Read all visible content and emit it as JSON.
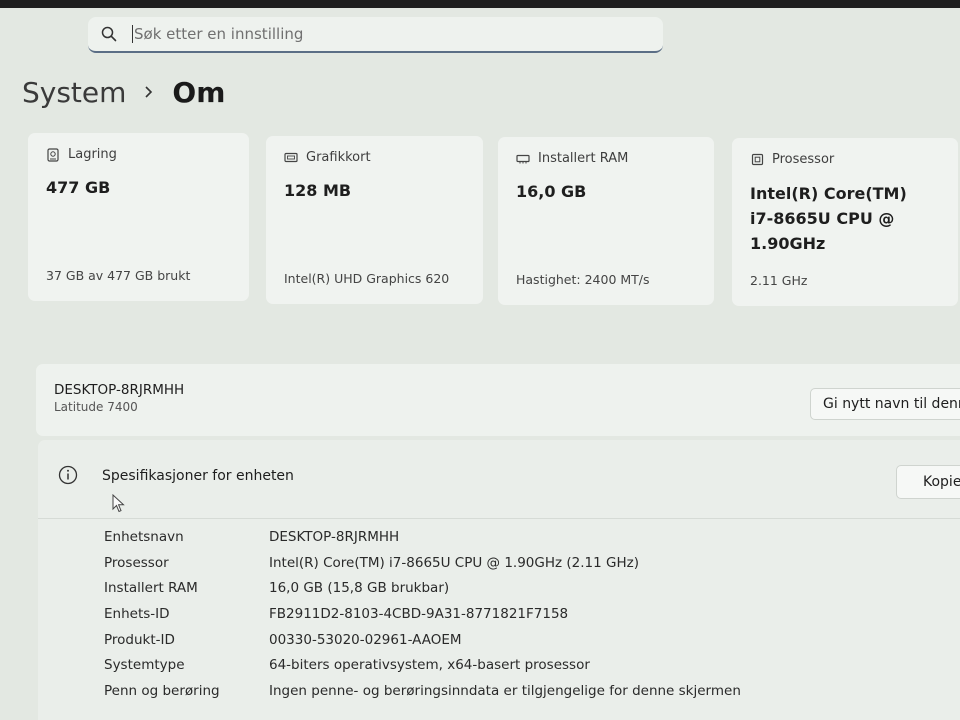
{
  "search": {
    "placeholder": "Søk etter en innstilling"
  },
  "breadcrumb": {
    "parent": "System",
    "current": "Om"
  },
  "cards": [
    {
      "title": "Lagring",
      "icon": "storage-icon",
      "value": "477 GB",
      "sub": "37 GB av 477 GB brukt"
    },
    {
      "title": "Grafikkort",
      "icon": "display-card-icon",
      "value": "128 MB",
      "sub": "Intel(R) UHD Graphics 620"
    },
    {
      "title": "Installert RAM",
      "icon": "ram-icon",
      "value": "16,0 GB",
      "sub": "Hastighet: 2400 MT/s"
    },
    {
      "title": "Prosessor",
      "icon": "processor-icon",
      "value_lines": [
        "Intel(R) Core(TM)",
        "i7-8665U CPU @",
        "1.90GHz"
      ],
      "sub": "2.11 GHz"
    }
  ],
  "device": {
    "name": "DESKTOP-8RJRMHH",
    "model": "Latitude 7400",
    "rename_label": "Gi nytt navn til denne PC-en"
  },
  "specs": {
    "title": "Spesifikasjoner for enheten",
    "copy_label": "Kopier",
    "rows": [
      {
        "label": "Enhetsnavn",
        "value": "DESKTOP-8RJRMHH"
      },
      {
        "label": "Prosessor",
        "value": "Intel(R) Core(TM) i7-8665U CPU @ 1.90GHz (2.11 GHz)"
      },
      {
        "label": "Installert RAM",
        "value": "16,0 GB (15,8 GB brukbar)"
      },
      {
        "label": "Enhets-ID",
        "value": "FB2911D2-8103-4CBD-9A31-8771821F7158"
      },
      {
        "label": "Produkt-ID",
        "value": "00330-53020-02961-AAOEM"
      },
      {
        "label": "Systemtype",
        "value": "64-biters operativsystem, x64-basert prosessor"
      },
      {
        "label": "Penn og berøring",
        "value": "Ingen penne- og berøringsinndata er tilgjengelige for denne skjermen"
      }
    ]
  },
  "colors": {
    "background": "#e3e8e2",
    "card": "#f0f3f0",
    "accent_underline": "#5b6e86"
  }
}
